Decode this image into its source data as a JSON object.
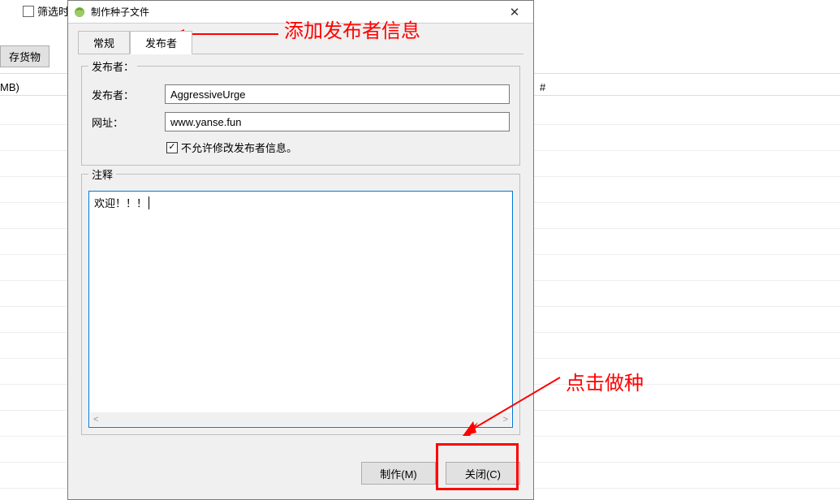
{
  "background": {
    "filter_checkbox": "筛选时",
    "store_button": "存货物",
    "col1": "MB)",
    "col2": "#"
  },
  "dialog": {
    "title": "制作种子文件",
    "tabs": [
      "常规",
      "发布者"
    ],
    "publisher": {
      "group_label": "发布者：",
      "name_label": "发布者：",
      "name_value": "AggressiveUrge",
      "url_label": "网址：",
      "url_value": "www.yanse.fun",
      "lock_checkbox_label": "不允许修改发布者信息。"
    },
    "comment": {
      "group_label": "注释",
      "value": "欢迎！！！"
    },
    "buttons": {
      "make": "制作(M)",
      "close": "关闭(C)"
    }
  },
  "annotations": {
    "top": "添加发布者信息",
    "right": "点击做种"
  }
}
